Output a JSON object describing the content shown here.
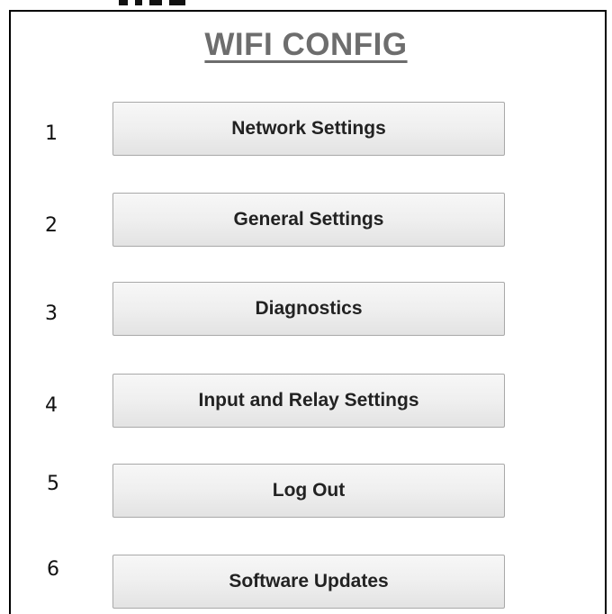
{
  "page": {
    "title": "WIFI CONFIG"
  },
  "menu": [
    {
      "number": "1",
      "label": "Network Settings"
    },
    {
      "number": "2",
      "label": "General Settings"
    },
    {
      "number": "3",
      "label": "Diagnostics"
    },
    {
      "number": "4",
      "label": "Input and Relay Settings"
    },
    {
      "number": "5",
      "label": "Log Out"
    },
    {
      "number": "6",
      "label": "Software Updates"
    }
  ]
}
